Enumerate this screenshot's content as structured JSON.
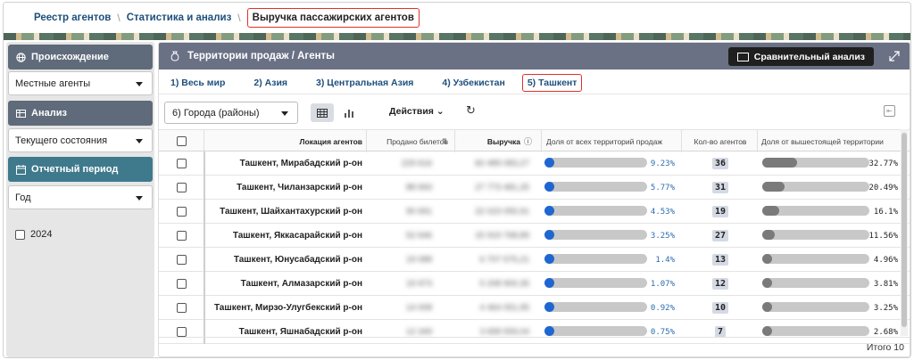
{
  "breadcrumb": {
    "items": [
      "Реестр агентов",
      "Статистика и анализ"
    ],
    "current": "Выручка пассажирских агентов"
  },
  "left_panel": {
    "origin": {
      "label": "Происхождение",
      "value": "Местные агенты"
    },
    "analysis": {
      "label": "Анализ",
      "value": "Текущего состояния"
    },
    "period": {
      "label": "Отчетный период",
      "value": "Год"
    },
    "year_option": {
      "label": "2024",
      "checked": false
    }
  },
  "main": {
    "title": "Территории продаж / Агенты",
    "compare_button": "Сравнительный анализ",
    "tabs": [
      "1) Весь мир",
      "2) Азия",
      "3) Центральная Азия",
      "4) Узбекистан",
      "5) Ташкент"
    ],
    "active_tab_index": 4,
    "level_select": "6) Города (районы)",
    "actions_label": "Действия",
    "columns": {
      "location": "Локация агентов",
      "tickets": "Продано билетов",
      "revenue": "Выручка",
      "share_all": "Доля от всех территорий продаж",
      "agents": "Кол-во агентов",
      "share_parent": "Доля от вышестоящей территории"
    },
    "rows": [
      {
        "location": "Ташкент, Мирабадский р-он",
        "tickets": "229 616",
        "revenue": "60 489 083,27",
        "share_all": "9.23%",
        "share_all_value": 9.23,
        "agents": "36",
        "share_parent": "32.77%",
        "share_parent_value": 32.77
      },
      {
        "location": "Ташкент, Чиланзарский р-он",
        "tickets": "88 693",
        "revenue": "27 773 481,25",
        "share_all": "5.77%",
        "share_all_value": 5.77,
        "agents": "31",
        "share_parent": "20.49%",
        "share_parent_value": 20.49
      },
      {
        "location": "Ташкент, Шайхантахурский р-он",
        "tickets": "90 691",
        "revenue": "22 023 055,91",
        "share_all": "4.53%",
        "share_all_value": 4.53,
        "agents": "19",
        "share_parent": "16.1%",
        "share_parent_value": 16.1
      },
      {
        "location": "Ташкент, Яккасарайский р-он",
        "tickets": "52 646",
        "revenue": "15 919 768,89",
        "share_all": "3.25%",
        "share_all_value": 3.25,
        "agents": "27",
        "share_parent": "11.56%",
        "share_parent_value": 11.56
      },
      {
        "location": "Ташкент, Юнусабадский р-он",
        "tickets": "19 088",
        "revenue": "6 707 575,21",
        "share_all": "1.4%",
        "share_all_value": 1.4,
        "agents": "13",
        "share_parent": "4.96%",
        "share_parent_value": 4.96
      },
      {
        "location": "Ташкент, Алмазарский р-он",
        "tickets": "19 973",
        "revenue": "5 208 900,35",
        "share_all": "1.07%",
        "share_all_value": 1.07,
        "agents": "12",
        "share_parent": "3.81%",
        "share_parent_value": 3.81
      },
      {
        "location": "Ташкент, Мирзо-Улугбекский р-он",
        "tickets": "14 008",
        "revenue": "4 464 051,95",
        "share_all": "0.92%",
        "share_all_value": 0.92,
        "agents": "10",
        "share_parent": "3.25%",
        "share_parent_value": 3.25
      },
      {
        "location": "Ташкент, Яшнабадский р-он",
        "tickets": "12 349",
        "revenue": "3 658 559,04",
        "share_all": "0.75%",
        "share_all_value": 0.75,
        "agents": "7",
        "share_parent": "2.68%",
        "share_parent_value": 2.68
      }
    ],
    "total_label": "Итого 10"
  },
  "colors": {
    "accent_blue": "#2b6cb0",
    "bar_fill_blue": "#1f66d1",
    "bar_fill_gray": "#7a7a7a",
    "header_slate": "#6a7185",
    "highlight_red": "#e0312a"
  }
}
